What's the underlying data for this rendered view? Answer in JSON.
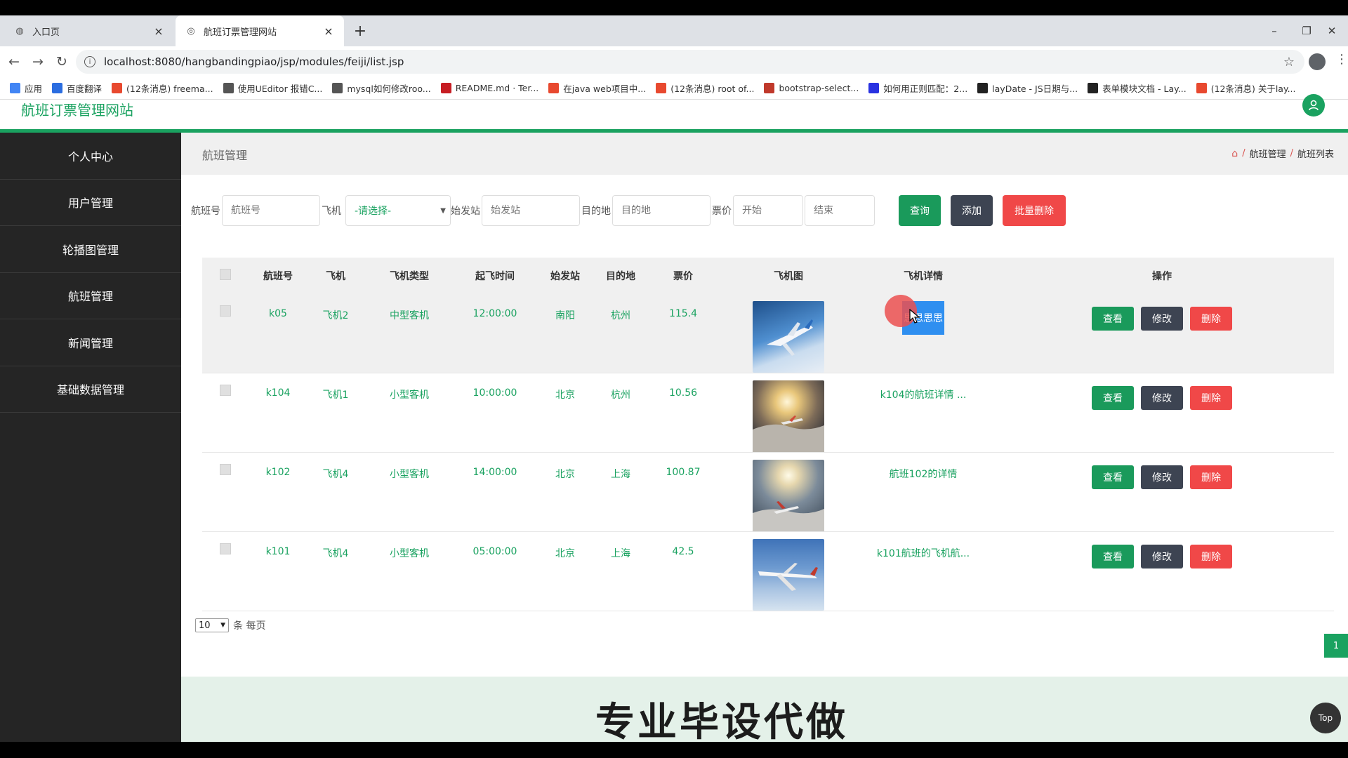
{
  "browser": {
    "tabs": [
      {
        "title": "入口页",
        "active": false
      },
      {
        "title": "航班订票管理网站",
        "active": true
      }
    ],
    "url": "localhost:8080/hangbandingpiao/jsp/modules/feiji/list.jsp",
    "bookmarks": [
      {
        "label": "应用",
        "icon": "apps-icon",
        "color": "#4285f4"
      },
      {
        "label": "百度翻译",
        "icon": "translate-icon",
        "color": "#2b6de0"
      },
      {
        "label": "(12条消息) freema...",
        "icon": "csdn-icon",
        "color": "#e8492f"
      },
      {
        "label": "使用UEditor 报错C...",
        "icon": "bookmark-icon",
        "color": "#555555"
      },
      {
        "label": "mysql如何修改roo...",
        "icon": "bookmark-icon",
        "color": "#555555"
      },
      {
        "label": "README.md · Ter...",
        "icon": "gitee-icon",
        "color": "#c71d23"
      },
      {
        "label": "在java web项目中...",
        "icon": "csdn-icon",
        "color": "#e8492f"
      },
      {
        "label": "(12条消息) root of...",
        "icon": "csdn-icon",
        "color": "#e8492f"
      },
      {
        "label": "bootstrap-select...",
        "icon": "bookmark-icon",
        "color": "#c0392b"
      },
      {
        "label": "如何用正则匹配：2...",
        "icon": "baidu-icon",
        "color": "#2932e1"
      },
      {
        "label": "layDate - JS日期与...",
        "icon": "layui-icon",
        "color": "#222222"
      },
      {
        "label": "表单模块文档 - Lay...",
        "icon": "layui-icon",
        "color": "#222222"
      },
      {
        "label": "(12条消息) 关于lay...",
        "icon": "csdn-icon",
        "color": "#e8492f"
      }
    ]
  },
  "site": {
    "title": "航班订票管理网站"
  },
  "sidebar": {
    "items": [
      {
        "label": "个人中心"
      },
      {
        "label": "用户管理"
      },
      {
        "label": "轮播图管理"
      },
      {
        "label": "航班管理"
      },
      {
        "label": "新闻管理"
      },
      {
        "label": "基础数据管理"
      }
    ]
  },
  "content": {
    "header": "航班管理",
    "breadcrumb": [
      "航班管理",
      "航班列表"
    ]
  },
  "search": {
    "flight_no_label": "航班号",
    "flight_no_placeholder": "航班号",
    "plane_label": "飞机",
    "plane_select": "-请选择-",
    "origin_label": "始发站",
    "origin_placeholder": "始发站",
    "dest_label": "目的地",
    "dest_placeholder": "目的地",
    "price_label": "票价",
    "price_start_placeholder": "开始",
    "price_end_placeholder": "结束",
    "query_btn": "查询",
    "add_btn": "添加",
    "batch_delete_btn": "批量删除"
  },
  "table": {
    "headers": [
      "航班号",
      "飞机",
      "飞机类型",
      "起飞时间",
      "始发站",
      "目的地",
      "票价",
      "飞机图",
      "飞机详情",
      "操作"
    ],
    "rows": [
      {
        "flight_no": "k05",
        "plane": "飞机2",
        "plane_type": "中型客机",
        "time": "12:00:00",
        "origin": "南阳",
        "dest": "杭州",
        "price": "115.4",
        "detail": "思思思思",
        "detail_selected": true
      },
      {
        "flight_no": "k104",
        "plane": "飞机1",
        "plane_type": "小型客机",
        "time": "10:00:00",
        "origin": "北京",
        "dest": "杭州",
        "price": "10.56",
        "detail": "k104的航班详情 ...",
        "detail_selected": false
      },
      {
        "flight_no": "k102",
        "plane": "飞机4",
        "plane_type": "小型客机",
        "time": "14:00:00",
        "origin": "北京",
        "dest": "上海",
        "price": "100.87",
        "detail": "航班102的详情",
        "detail_selected": false
      },
      {
        "flight_no": "k101",
        "plane": "飞机4",
        "plane_type": "小型客机",
        "time": "05:00:00",
        "origin": "北京",
        "dest": "上海",
        "price": "42.5",
        "detail": "k101航班的飞机航...",
        "detail_selected": false
      }
    ],
    "actions": {
      "view": "查看",
      "edit": "修改",
      "delete": "删除"
    }
  },
  "pagination": {
    "page_size": "10",
    "per_page_label": "条 每页",
    "current_page": "1"
  },
  "overlay": {
    "watermark": "专业毕设代做",
    "top_btn": "Top"
  },
  "colors": {
    "brand_green": "#1aa260",
    "query_btn": "#1a9a5b",
    "add_btn": "#3d4452",
    "delete_btn": "#f04848",
    "sidebar_bg": "#252525"
  }
}
